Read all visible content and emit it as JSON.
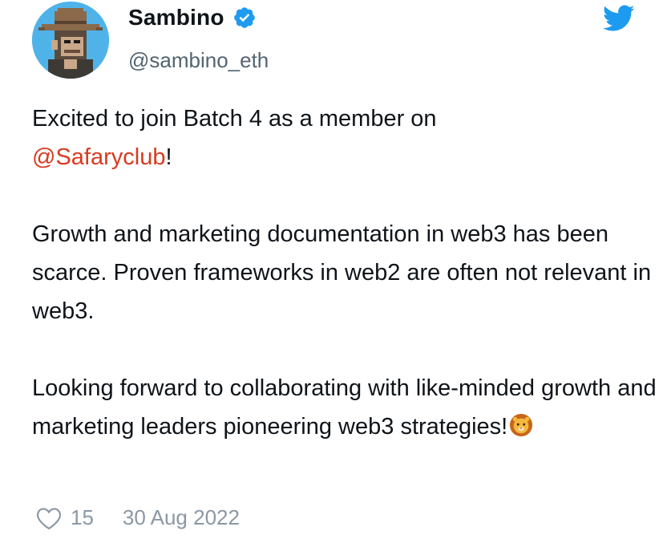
{
  "author": {
    "display_name": "Sambino",
    "handle": "@sambino_eth",
    "verified": true,
    "avatar_icon": "pixel-ape-cowboy-hat-avatar"
  },
  "tweet": {
    "line1_before": "Excited to join Batch 4 as a member on",
    "mention": "@Safaryclub",
    "mention_after": "!",
    "paragraph2": "Growth and marketing documentation in web3 has been scarce. Proven frameworks in web2 are often not relevant in web3.",
    "paragraph3": "Looking forward to collaborating with like-minded growth and marketing leaders pioneering web3 strategies!",
    "trailing_emoji": "lion-face-emoji"
  },
  "footer": {
    "like_count": "15",
    "date": "30 Aug 2022"
  },
  "icons": {
    "verified": "verified-badge-icon",
    "twitter": "twitter-bird-icon",
    "like": "heart-icon"
  },
  "colors": {
    "twitter_blue": "#1d9bf0",
    "mention": "#d93a1f",
    "muted_text": "#536471",
    "footer_text": "#8b98a5"
  }
}
